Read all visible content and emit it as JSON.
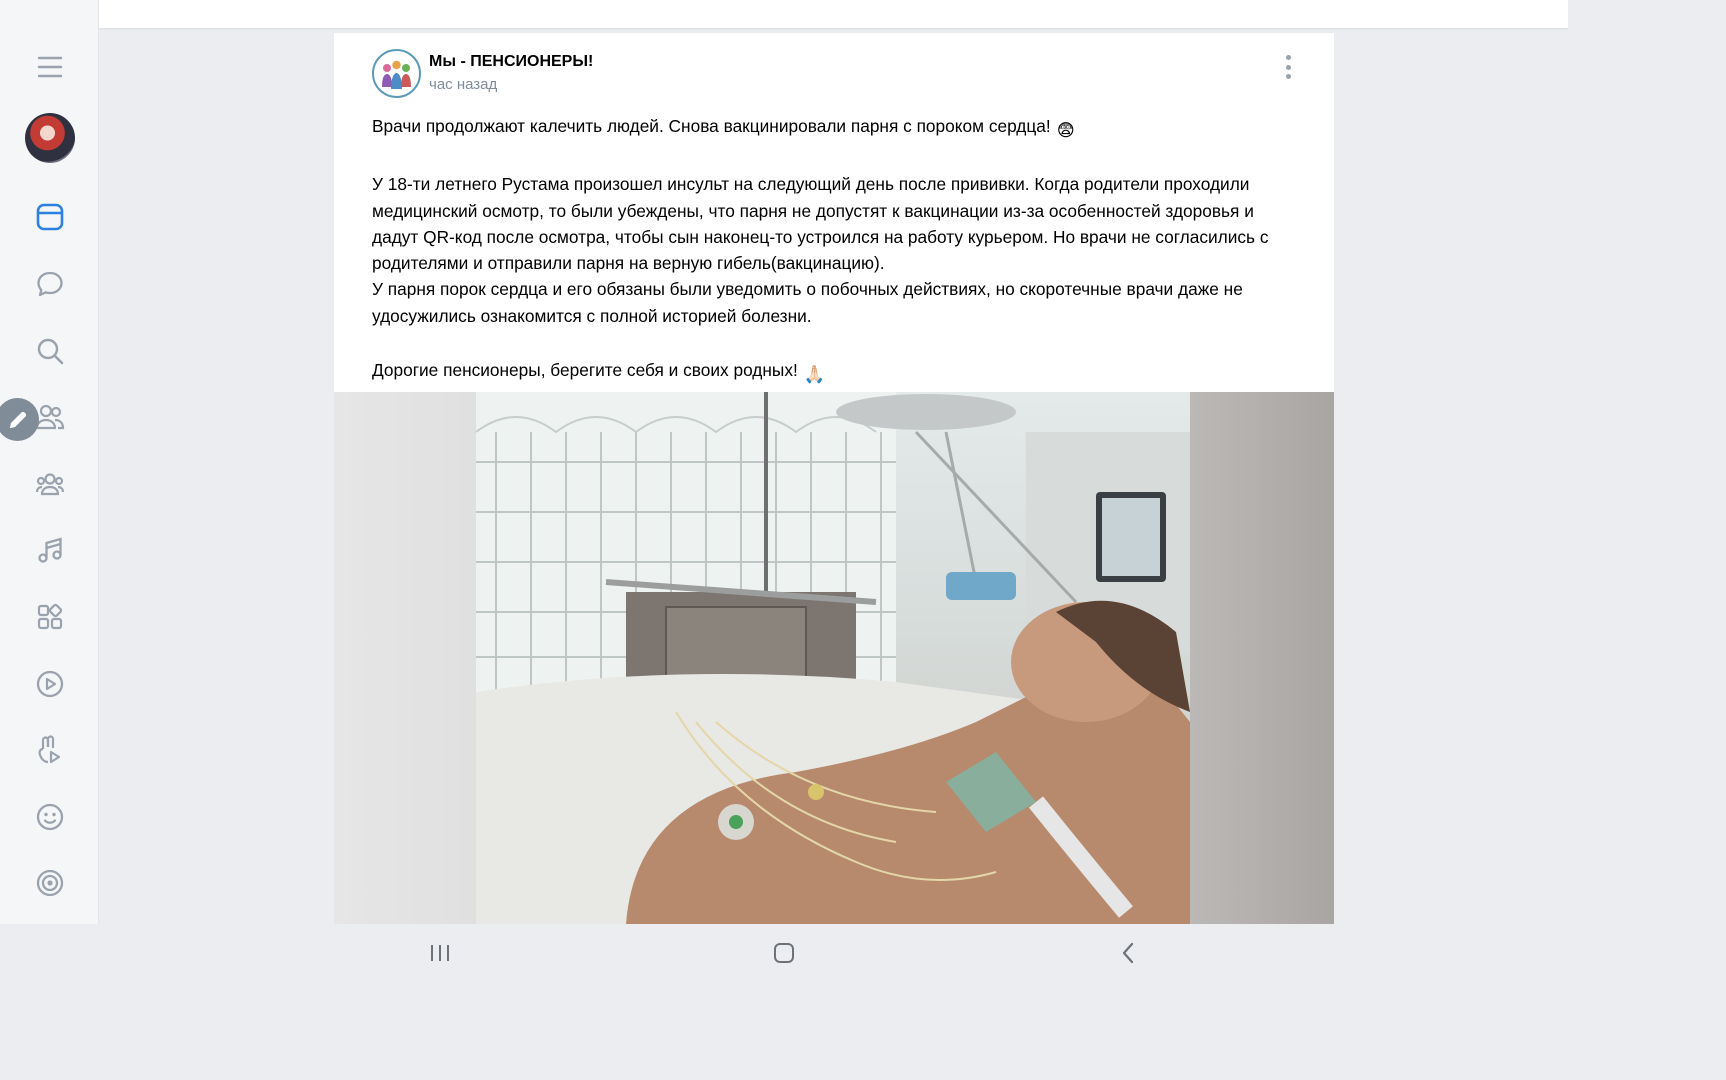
{
  "sidebar": {
    "items": [
      {
        "id": "menu",
        "icon": "hamburger-menu-icon"
      },
      {
        "id": "profile",
        "icon": "user-avatar"
      },
      {
        "id": "news",
        "icon": "newsfeed-icon",
        "active": true
      },
      {
        "id": "messages",
        "icon": "chat-bubble-icon"
      },
      {
        "id": "search",
        "icon": "search-icon"
      },
      {
        "id": "friends",
        "icon": "friends-icon"
      },
      {
        "id": "communities",
        "icon": "communities-icon"
      },
      {
        "id": "music",
        "icon": "music-note-icon"
      },
      {
        "id": "services",
        "icon": "apps-grid-icon"
      },
      {
        "id": "video",
        "icon": "play-circle-icon"
      },
      {
        "id": "clips",
        "icon": "clips-icon"
      },
      {
        "id": "stickers",
        "icon": "smiley-icon"
      },
      {
        "id": "games",
        "icon": "target-icon"
      }
    ],
    "edit_fab_icon": "pencil-icon"
  },
  "post": {
    "author": "Мы - ПЕНСИОНЕРЫ!",
    "time": "час назад",
    "paragraph1": "Врачи продолжают калечить людей. Снова вакцинировали парня с пороком сердца!",
    "paragraph1_emoji": "😨",
    "paragraph2": "У 18-ти летнего Рустама произошел инсульт на следующий день после прививки. Когда родители проходили медицинский осмотр, то были убеждены, что парня не допустят к вакцинации из-за особенностей здоровья и дадут QR-код после осмотра, чтобы сын наконец-то устроился на работу курьером. Но врачи не согласились с родителями и отправили парня на верную гибель(вакцинацию).",
    "paragraph3": "У парня порок сердца и его обязаны были уведомить о побочных действиях, но скоротечные врачи даже не удосужились ознакомится с полной историей болезни.",
    "paragraph4": "Дорогие пенсионеры, берегите себя и своих родных!",
    "paragraph4_emoji": "🙏🏻",
    "photo": "hospital-patient-photo"
  },
  "colors": {
    "accent": "#2d81e0",
    "icon_gray": "#99a2ad",
    "secondary_text": "#818c99",
    "background": "#ebedf0"
  },
  "system_nav": {
    "recents_icon": "recents-icon",
    "home_icon": "home-icon",
    "back_icon": "back-icon"
  }
}
